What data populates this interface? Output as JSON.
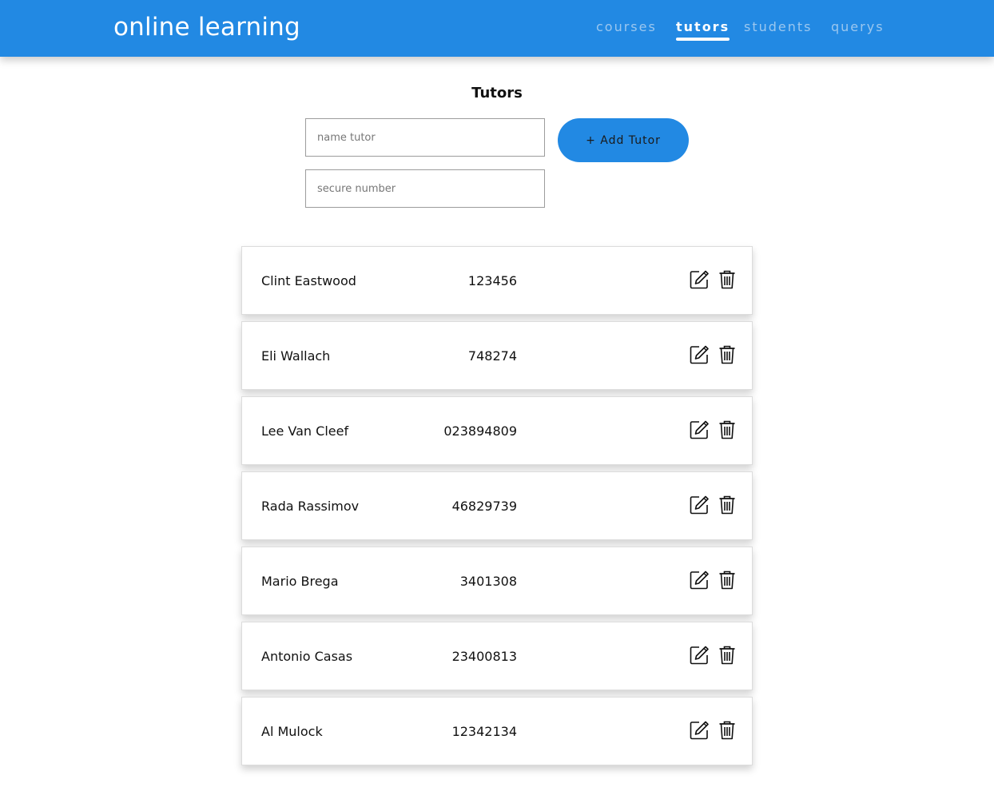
{
  "header": {
    "brand": "online learning",
    "nav": [
      {
        "label": "courses",
        "active": false
      },
      {
        "label": "tutors",
        "active": true
      },
      {
        "label": "students",
        "active": false
      },
      {
        "label": "querys",
        "active": false
      }
    ]
  },
  "main": {
    "title": "Tutors",
    "name_input": {
      "placeholder": "name tutor",
      "value": ""
    },
    "number_input": {
      "placeholder": "secure number",
      "value": ""
    },
    "add_button_label": "+ Add Tutor"
  },
  "tutors": [
    {
      "name": "Clint Eastwood",
      "number": "123456"
    },
    {
      "name": "Eli Wallach",
      "number": "748274"
    },
    {
      "name": "Lee Van Cleef",
      "number": "023894809"
    },
    {
      "name": "Rada Rassimov",
      "number": "46829739"
    },
    {
      "name": "Mario Brega",
      "number": "3401308"
    },
    {
      "name": "Antonio Casas",
      "number": "23400813"
    },
    {
      "name": "Al Mulock",
      "number": "12342134"
    }
  ],
  "icons": {
    "edit": "edit-icon",
    "delete": "trash-icon"
  },
  "colors": {
    "accent": "#2289e3",
    "nav_inactive": "#9bc7ef"
  }
}
